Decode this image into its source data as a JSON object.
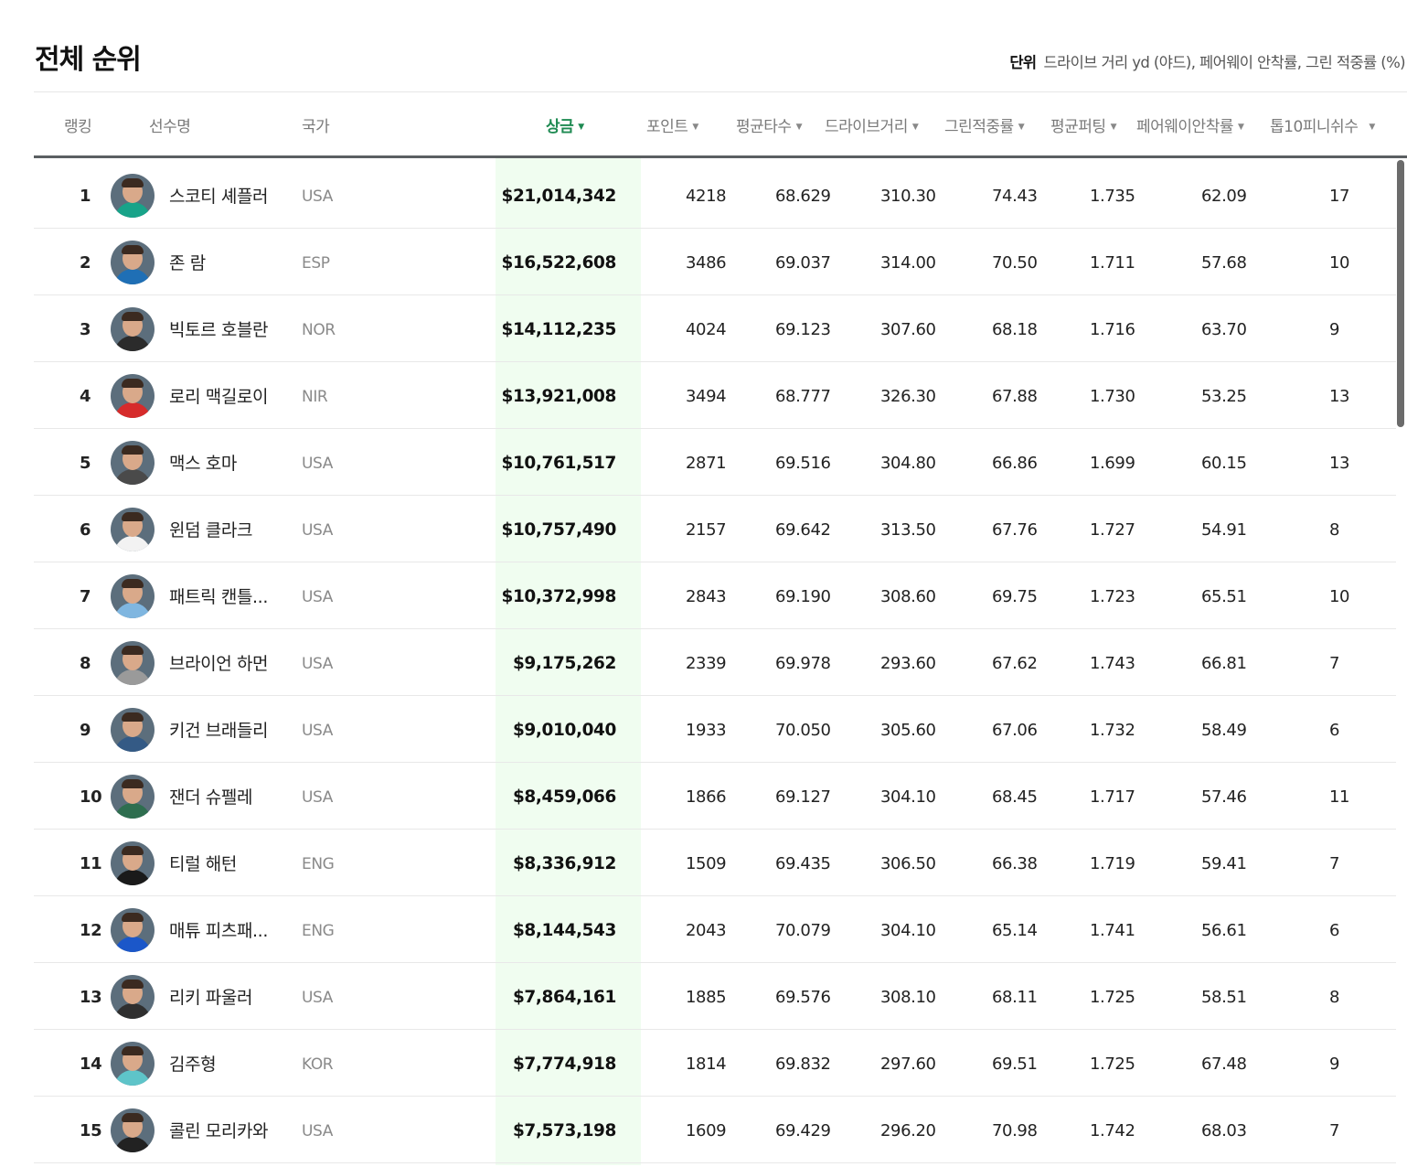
{
  "title": "전체 순위",
  "unit": {
    "label": "단위",
    "text": "드라이브 거리 yd (야드), 페어웨이 안착률, 그린 적중률 (%)"
  },
  "columns": {
    "rank": "랭킹",
    "name": "선수명",
    "nation": "국가",
    "prize": "상금",
    "points": "포인트",
    "avg_score": "평균타수",
    "drive": "드라이브거리",
    "gir": "그린적중률",
    "putting": "평균퍼팅",
    "fairway": "페어웨이안착률",
    "top10": "톱10피니쉬수"
  },
  "colors": {
    "accent": "#1e8a52",
    "prize_bg": "#f0fdf0"
  },
  "rows": [
    {
      "rank": "1",
      "name": "스코티 셰플러",
      "nation": "USA",
      "prize": "$21,014,342",
      "points": "4218",
      "avg_score": "68.629",
      "drive": "310.30",
      "gir": "74.43",
      "putting": "1.735",
      "fairway": "62.09",
      "top10": "17",
      "shirt": "#18a389"
    },
    {
      "rank": "2",
      "name": "존 람",
      "nation": "ESP",
      "prize": "$16,522,608",
      "points": "3486",
      "avg_score": "69.037",
      "drive": "314.00",
      "gir": "70.50",
      "putting": "1.711",
      "fairway": "57.68",
      "top10": "10",
      "shirt": "#1f6fb5"
    },
    {
      "rank": "3",
      "name": "빅토르 호블란",
      "nation": "NOR",
      "prize": "$14,112,235",
      "points": "4024",
      "avg_score": "69.123",
      "drive": "307.60",
      "gir": "68.18",
      "putting": "1.716",
      "fairway": "63.70",
      "top10": "9",
      "shirt": "#2b2b2b"
    },
    {
      "rank": "4",
      "name": "로리 맥길로이",
      "nation": "NIR",
      "prize": "$13,921,008",
      "points": "3494",
      "avg_score": "68.777",
      "drive": "326.30",
      "gir": "67.88",
      "putting": "1.730",
      "fairway": "53.25",
      "top10": "13",
      "shirt": "#d62b2b"
    },
    {
      "rank": "5",
      "name": "맥스 호마",
      "nation": "USA",
      "prize": "$10,761,517",
      "points": "2871",
      "avg_score": "69.516",
      "drive": "304.80",
      "gir": "66.86",
      "putting": "1.699",
      "fairway": "60.15",
      "top10": "13",
      "shirt": "#4a4a4a"
    },
    {
      "rank": "6",
      "name": "윈덤 클라크",
      "nation": "USA",
      "prize": "$10,757,490",
      "points": "2157",
      "avg_score": "69.642",
      "drive": "313.50",
      "gir": "67.76",
      "putting": "1.727",
      "fairway": "54.91",
      "top10": "8",
      "shirt": "#f2f2f2"
    },
    {
      "rank": "7",
      "name": "패트릭 캔틀...",
      "nation": "USA",
      "prize": "$10,372,998",
      "points": "2843",
      "avg_score": "69.190",
      "drive": "308.60",
      "gir": "69.75",
      "putting": "1.723",
      "fairway": "65.51",
      "top10": "10",
      "shirt": "#7fb6e0"
    },
    {
      "rank": "8",
      "name": "브라이언 하먼",
      "nation": "USA",
      "prize": "$9,175,262",
      "points": "2339",
      "avg_score": "69.978",
      "drive": "293.60",
      "gir": "67.62",
      "putting": "1.743",
      "fairway": "66.81",
      "top10": "7",
      "shirt": "#9a9a9a"
    },
    {
      "rank": "9",
      "name": "키건 브래들리",
      "nation": "USA",
      "prize": "$9,010,040",
      "points": "1933",
      "avg_score": "70.050",
      "drive": "305.60",
      "gir": "67.06",
      "putting": "1.732",
      "fairway": "58.49",
      "top10": "6",
      "shirt": "#345a85"
    },
    {
      "rank": "10",
      "name": "잰더 슈펠레",
      "nation": "USA",
      "prize": "$8,459,066",
      "points": "1866",
      "avg_score": "69.127",
      "drive": "304.10",
      "gir": "68.45",
      "putting": "1.717",
      "fairway": "57.46",
      "top10": "11",
      "shirt": "#2e6e4f"
    },
    {
      "rank": "11",
      "name": "티럴 해턴",
      "nation": "ENG",
      "prize": "$8,336,912",
      "points": "1509",
      "avg_score": "69.435",
      "drive": "306.50",
      "gir": "66.38",
      "putting": "1.719",
      "fairway": "59.41",
      "top10": "7",
      "shirt": "#1a1a1a"
    },
    {
      "rank": "12",
      "name": "매튜 피츠패...",
      "nation": "ENG",
      "prize": "$8,144,543",
      "points": "2043",
      "avg_score": "70.079",
      "drive": "304.10",
      "gir": "65.14",
      "putting": "1.741",
      "fairway": "56.61",
      "top10": "6",
      "shirt": "#1b57c9"
    },
    {
      "rank": "13",
      "name": "리키 파울러",
      "nation": "USA",
      "prize": "$7,864,161",
      "points": "1885",
      "avg_score": "69.576",
      "drive": "308.10",
      "gir": "68.11",
      "putting": "1.725",
      "fairway": "58.51",
      "top10": "8",
      "shirt": "#2f2f2f"
    },
    {
      "rank": "14",
      "name": "김주형",
      "nation": "KOR",
      "prize": "$7,774,918",
      "points": "1814",
      "avg_score": "69.832",
      "drive": "297.60",
      "gir": "69.51",
      "putting": "1.725",
      "fairway": "67.48",
      "top10": "9",
      "shirt": "#5ec4c9"
    },
    {
      "rank": "15",
      "name": "콜린 모리카와",
      "nation": "USA",
      "prize": "$7,573,198",
      "points": "1609",
      "avg_score": "69.429",
      "drive": "296.20",
      "gir": "70.98",
      "putting": "1.742",
      "fairway": "68.03",
      "top10": "7",
      "shirt": "#222222"
    }
  ]
}
